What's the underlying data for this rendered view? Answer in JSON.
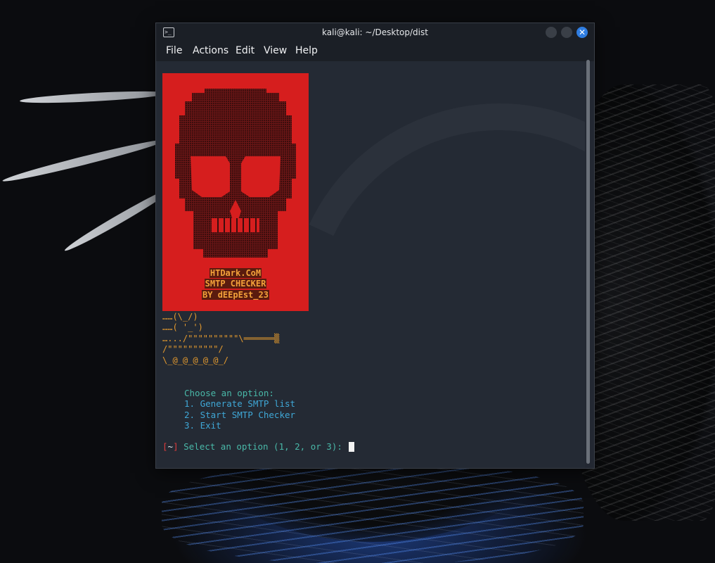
{
  "window": {
    "title": "kali@kali: ~/Desktop/dist",
    "close_glyph": "✕"
  },
  "menubar": {
    "items": [
      "File",
      "Actions",
      "Edit",
      "View",
      "Help"
    ]
  },
  "terminal": {
    "banner": {
      "line1": "HTDark.CoM",
      "line2": "SMTP CHECKER",
      "line3": "BY dEEpEst_23"
    },
    "ascii_art": [
      "……(\\_/)",
      "……( '_')",
      "….../\"\"\"\"\"\"\"\"\"\"\\══════▒",
      "/\"\"\"\"\"\"\"\"\"\"/",
      "\\_@_@_@_@_@_/"
    ],
    "menu": {
      "heading": "Choose an option:",
      "options": [
        "1. Generate SMTP list",
        "2. Start SMTP Checker",
        "3. Exit"
      ]
    },
    "prompt": {
      "open": "[",
      "tilde": "~",
      "close": "]",
      "text": " Select an option (1, 2, or 3): "
    }
  },
  "colors": {
    "accent": "#2f7de1",
    "terminal_bg": "#242a34",
    "banner_bg": "#d61e1e",
    "banner_text": "#f3a13a",
    "menu_text": "#49b8a8",
    "option_text": "#3fa7d6",
    "prompt_bracket": "#e03c3c"
  }
}
